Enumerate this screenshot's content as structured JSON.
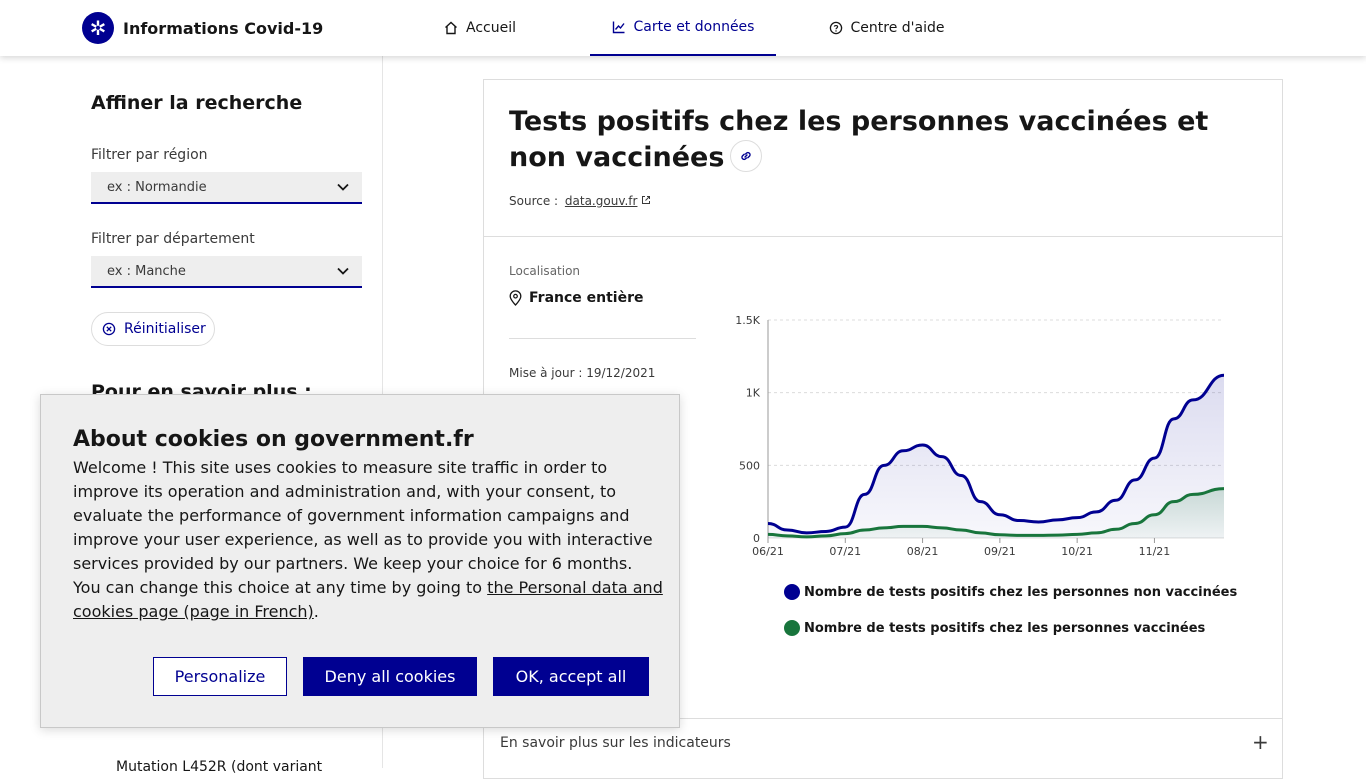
{
  "header": {
    "brand_title": "Informations Covid-19",
    "nav": [
      {
        "label": "Accueil",
        "icon": "home-icon"
      },
      {
        "label": "Carte et données",
        "icon": "chart-line-icon",
        "active": true
      },
      {
        "label": "Centre d'aide",
        "icon": "help-circle-icon"
      }
    ]
  },
  "sidebar": {
    "title": "Affiner la recherche",
    "region_label": "Filtrer par région",
    "region_value": "ex : Normandie",
    "department_label": "Filtrer par département",
    "department_value": "ex : Manche",
    "reset_label": "Réinitialiser",
    "learn_more_title": "Pour en savoir plus :",
    "mutation_text": "Mutation L452R (dont variant"
  },
  "card": {
    "title": "Tests positifs chez les personnes vaccinées et non vaccinées",
    "source_prefix": "Source :",
    "source_link": "data.gouv.fr",
    "location_label": "Localisation",
    "location_value": "France entière",
    "update_text": "Mise à jour : 19/12/2021",
    "more_label": "En savoir plus sur les indicateurs",
    "more_icon": "+"
  },
  "chart_data": {
    "type": "area",
    "x_ticks": [
      "06/21",
      "07/21",
      "08/21",
      "09/21",
      "10/21",
      "11/21"
    ],
    "y_ticks": [
      "0",
      "500",
      "1K",
      "1.5K"
    ],
    "ylim": [
      0,
      1500
    ],
    "grid": "horizontal dashed",
    "legend_position": "bottom",
    "x": [
      0,
      0.25,
      0.5,
      0.75,
      1,
      1.25,
      1.5,
      1.75,
      2,
      2.25,
      2.5,
      2.75,
      3,
      3.25,
      3.5,
      3.75,
      4,
      4.25,
      4.5,
      4.75,
      5,
      5.25,
      5.5,
      5.9
    ],
    "series": [
      {
        "name": "Nombre de tests positifs chez les personnes non vaccinées",
        "color": "#000091",
        "values": [
          100,
          55,
          35,
          45,
          75,
          300,
          500,
          600,
          640,
          560,
          430,
          250,
          160,
          120,
          110,
          125,
          140,
          180,
          260,
          400,
          550,
          820,
          950,
          1120
        ]
      },
      {
        "name": "Nombre de tests positifs chez les personnes vaccinées",
        "color": "#18753c",
        "values": [
          25,
          15,
          8,
          15,
          30,
          55,
          70,
          80,
          80,
          70,
          55,
          35,
          22,
          18,
          18,
          20,
          25,
          35,
          60,
          100,
          160,
          250,
          300,
          340
        ]
      }
    ]
  },
  "cookie": {
    "title": "About cookies on government.fr",
    "text_main": "Welcome ! This site uses cookies to measure site traffic in order to improve its operation and administration and, with your consent, to evaluate the performance of government information campaigns and improve your user experience, as well as to provide you with interactive services provided by our partners. We keep your choice for 6 months. You can change this choice at any time by going to ",
    "text_link": "the Personal data and cookies page (page in French)",
    "text_end": ".",
    "btn_personalize": "Personalize",
    "btn_deny": "Deny all cookies",
    "btn_accept": "OK, accept all",
    "accent": "#000091"
  }
}
